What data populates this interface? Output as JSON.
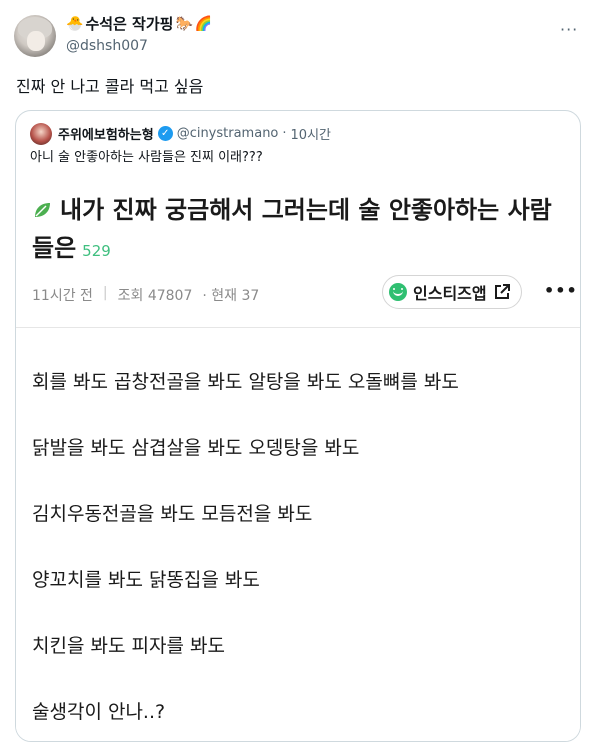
{
  "tweet": {
    "display_name": "수석은 작가핑",
    "name_emojis": [
      "🐣",
      "🐎",
      "🌈"
    ],
    "handle": "@dshsh007",
    "more": "···",
    "text": "진짜 안 나고 콜라 먹고 싶음"
  },
  "quote": {
    "name": "주위에보험하는형",
    "verified_mark": "✓",
    "handle": "@cinystramano",
    "separator": "·",
    "time": "10시간",
    "text": "아니 술 안좋아하는 사람들은 진찌 이래???",
    "post": {
      "title": "내가 진짜 궁금해서 그러는데 술 안좋아하는 사람들은",
      "comment_count": "529",
      "age": "11시간 전",
      "views": "조회 47807",
      "current": "· 현재 37",
      "app_label": "인스티즈앱",
      "more": "•••",
      "lines": [
        "회를 봐도 곱창전골을 봐도 알탕을 봐도 오돌뼈를 봐도",
        "닭발을 봐도 삼겹살을 봐도 오뎅탕을 봐도",
        "김치우동전골을 봐도 모듬전을 봐도",
        "양꼬치를 봐도 닭똥집을 봐도",
        "치킨을 봐도 피자를 봐도",
        "술생각이 안나..?"
      ]
    }
  },
  "colors": {
    "accent_blue": "#1d9bf0",
    "comment_green": "#3fbf7f",
    "app_green": "#2fbf71"
  },
  "icons": [
    "avatar",
    "verified-icon",
    "leaf-icon",
    "smile-icon",
    "external-link-icon",
    "more-icon"
  ]
}
